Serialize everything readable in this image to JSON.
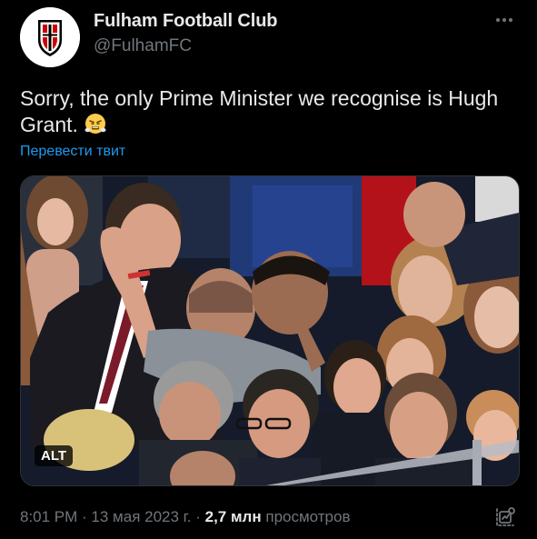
{
  "tweet": {
    "author": {
      "name": "Fulham Football Club",
      "handle": "@FulhamFC",
      "avatar_icon": "fulham-crest-icon"
    },
    "more_icon": "more-dots-icon",
    "text": "Sorry, the only Prime Minister we recognise is Hugh Grant.",
    "emoji_icon": "face-with-steam-emoji",
    "translate_label": "Перевести твит",
    "media": {
      "image_icon": "stadium-crowd-photo",
      "alt_label": "ALT"
    },
    "meta": {
      "time": "8:01 PM",
      "separator": " · ",
      "date": "13 мая 2023 г.",
      "views_count": "2,7 млн",
      "views_label": "просмотров"
    },
    "analytics_icon": "analytics-icon"
  },
  "colors": {
    "background": "#000000",
    "text": "#e7e9ea",
    "secondary": "#71767b",
    "link": "#1d9bf0"
  }
}
